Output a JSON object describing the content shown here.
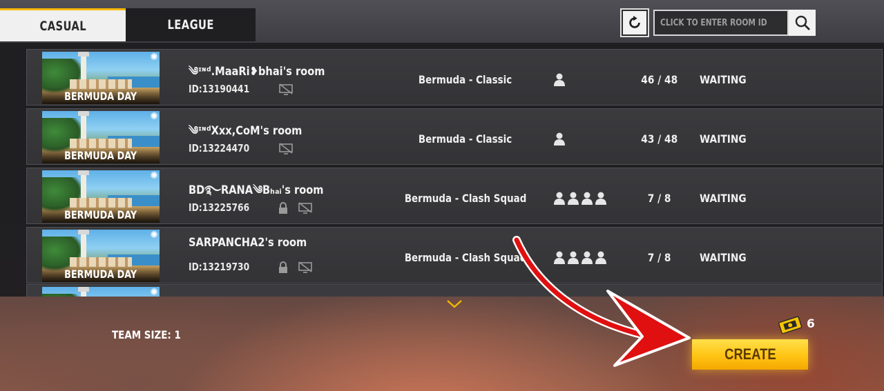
{
  "tabs": [
    {
      "label": "CASUAL",
      "active": true
    },
    {
      "label": "LEAGUE",
      "active": false
    }
  ],
  "search": {
    "placeholder": "CLICK TO ENTER ROOM ID"
  },
  "thumbnail_label": "BERMUDA DAY",
  "rooms": [
    {
      "name": "༄ᶦᶰᵈ.MaaRi❥bhai's room",
      "id": "ID:13190441",
      "locked": false,
      "mode": "Bermuda - Classic",
      "team_icons": 1,
      "count": "46 / 48",
      "status": "WAITING"
    },
    {
      "name": "༄ᶦᶰᵈXxx,CoM's room",
      "id": "ID:13224470",
      "locked": false,
      "mode": "Bermuda - Classic",
      "team_icons": 1,
      "count": "43 / 48",
      "status": "WAITING"
    },
    {
      "name": "BD࿐RANA༄Bₕₐᵢ's room",
      "id": "ID:13225766",
      "locked": true,
      "mode": "Bermuda - Clash Squad",
      "team_icons": 4,
      "count": "7 / 8",
      "status": "WAITING"
    },
    {
      "name": "SARPANCHA2's room",
      "id": "ID:13219730",
      "locked": true,
      "mode": "Bermuda - Clash Squad",
      "team_icons": 4,
      "count": "7 / 8",
      "status": "WAITING"
    }
  ],
  "footer": {
    "team_size": "TEAM SIZE: 1",
    "voucher_count": "6",
    "create_label": "CREATE"
  },
  "colors": {
    "accent": "#f5b800",
    "create_button": "#ffc414",
    "arrow": "#e01010"
  }
}
